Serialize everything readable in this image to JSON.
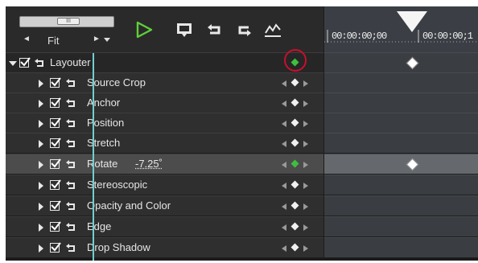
{
  "toolbar": {
    "fit_label": "Fit",
    "fit_left_arrow": "◄",
    "fit_right_arrow": "►",
    "scroll_thumb": "III",
    "icons": [
      "play-icon",
      "preview-icon",
      "undo-icon",
      "export-icon",
      "graph-icon"
    ],
    "colors": {
      "play": "#5fcf3a",
      "icon": "#e8e8e8"
    }
  },
  "timeline": {
    "timecodes": [
      "00:00:00;00",
      "00:00:00;1"
    ],
    "playhead_color": "#6fd0cf"
  },
  "rows": [
    {
      "label": "Layouter",
      "checked": true,
      "expanded": true,
      "level": 0,
      "keyframe_active": true
    },
    {
      "label": "Source Crop",
      "checked": true,
      "expanded": false,
      "level": 1
    },
    {
      "label": "Anchor",
      "checked": true,
      "expanded": false,
      "level": 1
    },
    {
      "label": "Position",
      "checked": true,
      "expanded": false,
      "level": 1
    },
    {
      "label": "Stretch",
      "checked": true,
      "expanded": false,
      "level": 1
    },
    {
      "label": "Rotate",
      "value": "-7.25˚",
      "checked": true,
      "expanded": false,
      "level": 1,
      "selected": true,
      "keyframe_active": true
    },
    {
      "label": "Stereoscopic",
      "checked": true,
      "expanded": false,
      "level": 1
    },
    {
      "label": "Opacity and Color",
      "checked": true,
      "expanded": false,
      "level": 1
    },
    {
      "label": "Edge",
      "checked": true,
      "expanded": false,
      "level": 1
    },
    {
      "label": "Drop Shadow",
      "checked": true,
      "expanded": false,
      "level": 1
    }
  ],
  "annotation": {
    "color": "#c8102e"
  }
}
